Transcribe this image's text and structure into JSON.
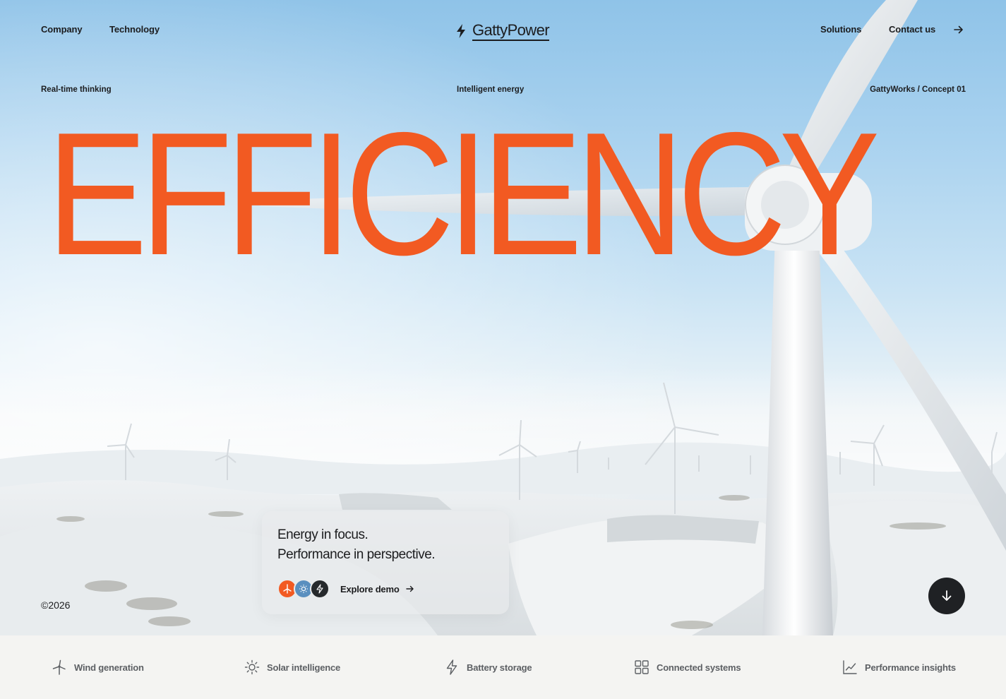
{
  "nav": {
    "company": "Company",
    "technology": "Technology",
    "solutions": "Solutions",
    "contact": "Contact us",
    "contact_icon": "arrow-right-icon"
  },
  "brand": {
    "name": "GattyPower",
    "icon": "bolt-icon"
  },
  "subheader": {
    "left": "Real-time thinking",
    "middle": "Intelligent energy",
    "right": "GattyWorks / Concept 01"
  },
  "headline": "EFFICIENCY",
  "copyright": "©2026",
  "card": {
    "line1": "Energy in focus.",
    "line2": "Performance in perspective.",
    "badges": [
      "wind-icon",
      "sun-icon",
      "bolt-icon"
    ],
    "cta": "Explore demo"
  },
  "scroll_button_icon": "arrow-down-icon",
  "features": [
    {
      "label": "Wind generation",
      "icon": "wind-turbine-icon"
    },
    {
      "label": "Solar intelligence",
      "icon": "sun-icon"
    },
    {
      "label": "Battery storage",
      "icon": "bolt-icon"
    },
    {
      "label": "Connected systems",
      "icon": "grid-icon"
    },
    {
      "label": "Performance insights",
      "icon": "line-chart-icon"
    }
  ],
  "colors": {
    "accent": "#f25a22",
    "dark": "#1f2124",
    "sky": "#a9d2ef",
    "footer_bg": "#f4f4f2"
  }
}
